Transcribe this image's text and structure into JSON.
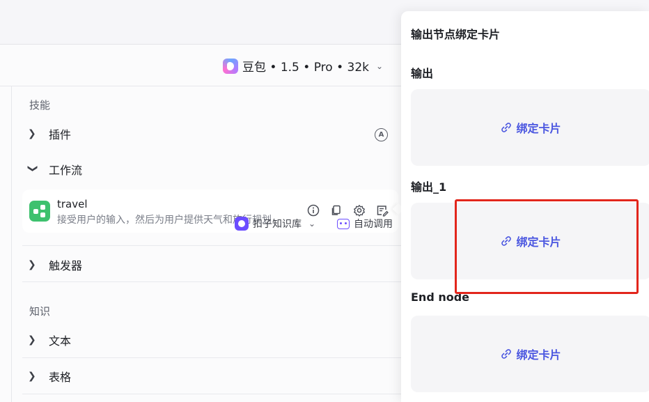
{
  "model": {
    "name": "豆包 • 1.5 • Pro • 32k"
  },
  "skills": {
    "title": "技能",
    "plugins_label": "插件",
    "auto_icon_letter": "A",
    "workflow_label": "工作流",
    "workflow_item": {
      "name": "travel",
      "description": "接受用户的输入，然后为用户提供天气和旅行规划"
    },
    "trigger_label": "触发器"
  },
  "knowledge": {
    "title": "知识",
    "kb_select_label": "扣子知识库",
    "auto_call_label": "自动调用",
    "text_label": "文本",
    "table_label": "表格"
  },
  "popover": {
    "title": "输出节点绑定卡片",
    "sections": [
      {
        "label": "输出",
        "bind_label": "绑定卡片"
      },
      {
        "label": "输出_1",
        "bind_label": "绑定卡片"
      },
      {
        "label": "End node",
        "bind_label": "绑定卡片"
      }
    ]
  },
  "colors": {
    "accent": "#4a56e0",
    "workflow_icon": "#3ec16e",
    "highlight": "#e2261c",
    "kb_avatar": "#6b4dff"
  }
}
